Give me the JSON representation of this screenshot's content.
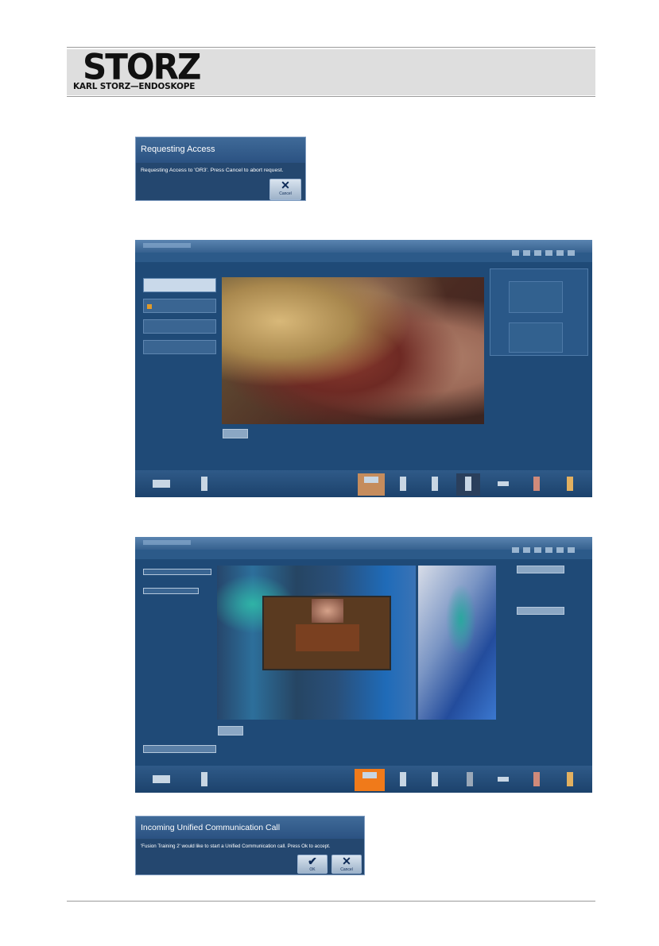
{
  "header": {
    "logo_main": "STORZ",
    "logo_sub": "KARL STORZ—ENDOSKOPE"
  },
  "dialog_access": {
    "title": "Requesting Access",
    "message": "Requesting Access to 'OR3'. Press Cancel to abort request.",
    "cancel_label": "Cancel",
    "cancel_glyph": "✕"
  },
  "dialog_call": {
    "title": "Incoming Unified Communication Call",
    "message": "'Fusion Training 2' would like to start a Unified Communication call.  Press Ok to accept.",
    "ok_label": "OK",
    "ok_glyph": "✔",
    "cancel_label": "Cancel",
    "cancel_glyph": "✕"
  },
  "colors": {
    "app_bg": "#1f4a77",
    "accent_orange": "#f07a1a"
  }
}
